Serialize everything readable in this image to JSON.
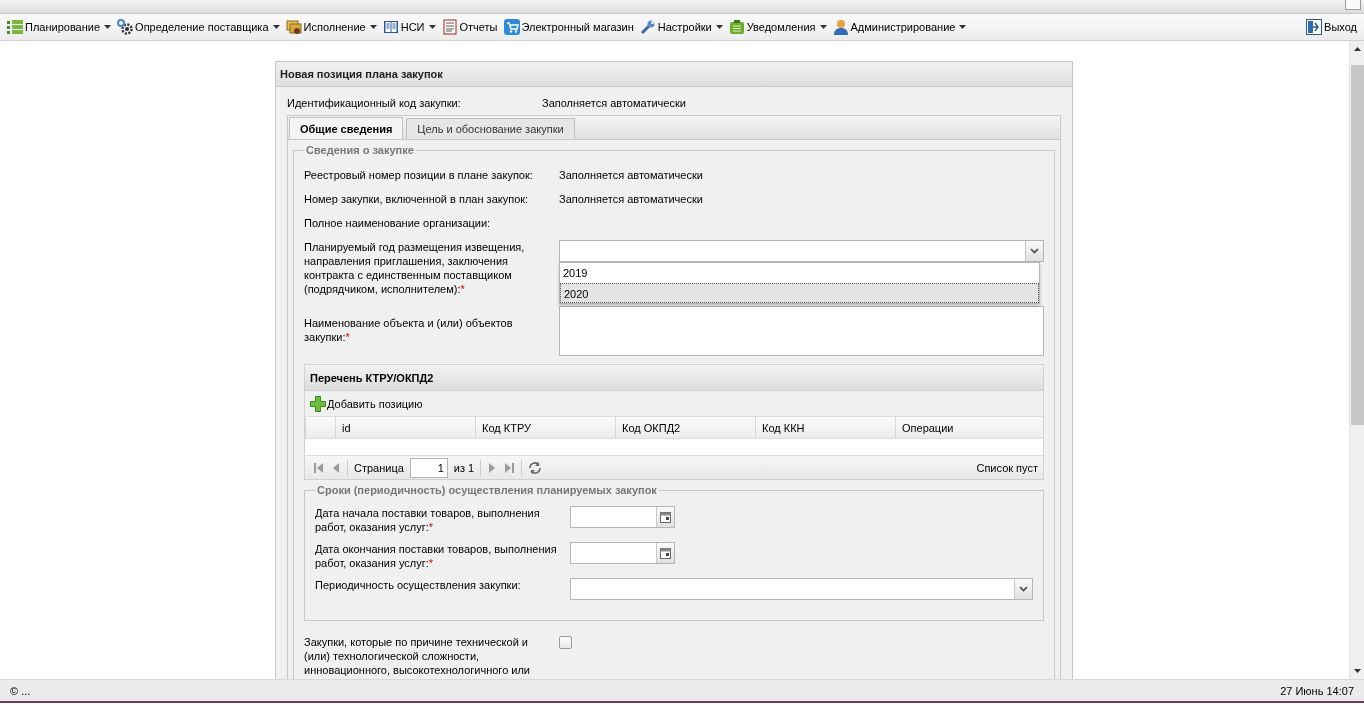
{
  "menu": [
    {
      "label": "Планирование",
      "dropdown": true
    },
    {
      "label": "Определение поставщика",
      "dropdown": true
    },
    {
      "label": "Исполнение",
      "dropdown": true
    },
    {
      "label": "НСИ",
      "dropdown": true
    },
    {
      "label": "Отчеты",
      "dropdown": false
    },
    {
      "label": "Электронный магазин",
      "dropdown": false
    },
    {
      "label": "Настройки",
      "dropdown": true
    },
    {
      "label": "Уведомления",
      "dropdown": true
    },
    {
      "label": "Администрирование",
      "dropdown": true
    }
  ],
  "logout": {
    "label": "Выход"
  },
  "panel": {
    "title": "Новая позиция плана закупок",
    "id_label": "Идентификационный код закупки:",
    "id_value": "Заполняется автоматически",
    "tabs": [
      {
        "label": "Общие сведения",
        "selected": true
      },
      {
        "label": "Цель и обоснование закупки",
        "selected": false
      }
    ],
    "section": {
      "legend": "Сведения о закупке",
      "fields": [
        {
          "kind": "static",
          "label": "Реестровый номер позиции в плане закупок:",
          "value": "Заполняется автоматически"
        },
        {
          "kind": "static",
          "label": "Номер закупки, включенной в план закупок:",
          "value": "Заполняется автоматически"
        },
        {
          "kind": "static",
          "label": "Полное наименование организации:"
        },
        {
          "kind": "combo",
          "label": "Планируемый год размещения извещения, направления приглашения, заключения контракта с единственным поставщиком (подрядчиком, исполнителем):",
          "mark": "*",
          "expanded": true,
          "options": [
            {
              "label": "2019",
              "selected": false
            },
            {
              "label": "2020",
              "selected": true
            }
          ]
        },
        {
          "kind": "textarea",
          "label": "Наименование объекта и (или) объектов закупки:",
          "mark": "*"
        }
      ]
    },
    "grid": {
      "title": "Перечень КТРУ/ОКПД2",
      "add_label": "Добавить позицию",
      "columns": [
        "id",
        "Код КТРУ",
        "Код ОКПД2",
        "Код ККН",
        "Операции"
      ],
      "page_label": "Страница",
      "page": "1",
      "of_label": "из 1",
      "empty_text": "Список пуст"
    },
    "terms": {
      "legend": "Сроки (периодичность) осуществления планируемых закупок",
      "fields": [
        {
          "kind": "date",
          "label": "Дата начала поставки товаров, выполнения работ, оказания услуг:",
          "mark": "*"
        },
        {
          "kind": "date",
          "label": "Дата окончания поставки товаров, выполнения работ, оказания услуг:",
          "mark": "*"
        },
        {
          "kind": "combo",
          "label": "Периодичность осуществления закупки:",
          "expanded": false
        }
      ]
    },
    "flag": {
      "label": "Закупки, которые по причине технической и (или) технологической сложности, инновационного, высокотехнологичного или",
      "checked": false
    }
  },
  "status": {
    "left": "© ...",
    "right": "27 Июнь 14:07"
  }
}
